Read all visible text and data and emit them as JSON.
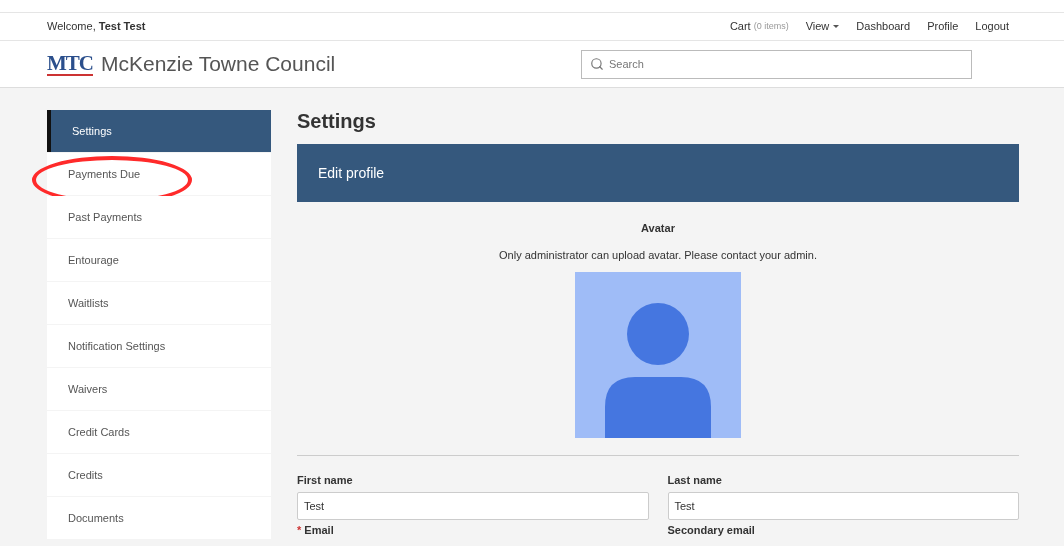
{
  "top_bar": {
    "welcome": "Welcome, **Test Test**",
    "links": [
      {
        "label": "Cart",
        "note": "(0 items)",
        "kind": "link"
      },
      {
        "label": "View",
        "kind": "dropdown"
      },
      {
        "label": "Dashboard",
        "kind": "link"
      },
      {
        "label": "Profile",
        "kind": "link"
      },
      {
        "label": "Logout",
        "kind": "link"
      }
    ]
  },
  "header": {
    "logo": "MTC",
    "site_name": "McKenzie Towne Council",
    "search": {
      "placeholder": "Search"
    }
  },
  "sidebar": {
    "items": [
      {
        "label": "Settings",
        "selected": true,
        "highlighted": false
      },
      {
        "label": "Payments Due",
        "selected": false,
        "highlighted": true
      },
      {
        "label": "Past Payments",
        "selected": false,
        "highlighted": false
      },
      {
        "label": "Entourage",
        "selected": false,
        "highlighted": false
      },
      {
        "label": "Waitlists",
        "selected": false,
        "highlighted": false
      },
      {
        "label": "Notification Settings",
        "selected": false,
        "highlighted": false
      },
      {
        "label": "Waivers",
        "selected": false,
        "highlighted": false
      },
      {
        "label": "Credit Cards",
        "selected": false,
        "highlighted": false
      },
      {
        "label": "Credits",
        "selected": false,
        "highlighted": false
      },
      {
        "label": "Documents",
        "selected": false,
        "highlighted": false
      }
    ]
  },
  "main": {
    "title": "Settings",
    "required_mark": "*",
    "banner": "Edit profile",
    "avatar": {
      "label": "Avatar",
      "note": "Only administrator can upload avatar. Please contact your admin."
    },
    "fields": [
      {
        "label": "First name",
        "value": "Test",
        "required": false
      },
      {
        "label": "Last name",
        "value": "Test",
        "required": false
      },
      {
        "label": "Email",
        "required": true
      },
      {
        "label": "Secondary email",
        "required": false
      }
    ]
  }
}
